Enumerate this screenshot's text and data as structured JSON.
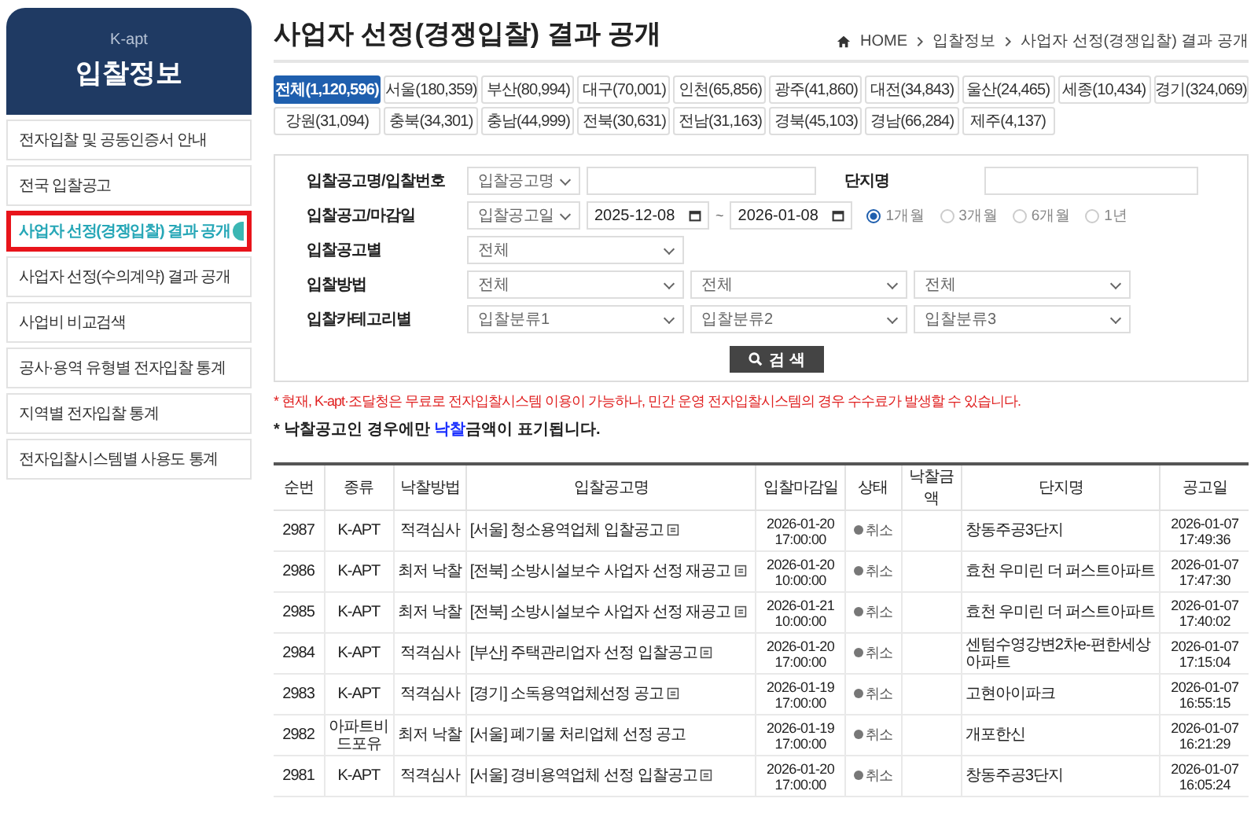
{
  "sidebar": {
    "brand": "K-apt",
    "title": "입찰정보",
    "items": [
      {
        "label": "전자입찰 및 공동인증서 안내",
        "selected": false
      },
      {
        "label": "전국 입찰공고",
        "selected": false
      },
      {
        "label": "사업자 선정(경쟁입찰) 결과 공개",
        "selected": true
      },
      {
        "label": "사업자 선정(수의계약) 결과 공개",
        "selected": false
      },
      {
        "label": "사업비 비교검색",
        "selected": false
      },
      {
        "label": "공사·용역 유형별 전자입찰 통계",
        "selected": false
      },
      {
        "label": "지역별 전자입찰 통계",
        "selected": false
      },
      {
        "label": "전자입찰시스템별 사용도 통계",
        "selected": false
      }
    ]
  },
  "page_title": "사업자 선정(경쟁입찰) 결과 공개",
  "breadcrumb": [
    "HOME",
    "입찰정보",
    "사업자 선정(경쟁입찰) 결과 공개"
  ],
  "regions": [
    {
      "label": "전체(1,120,596)",
      "selected": true
    },
    {
      "label": "서울(180,359)",
      "selected": false
    },
    {
      "label": "부산(80,994)",
      "selected": false
    },
    {
      "label": "대구(70,001)",
      "selected": false
    },
    {
      "label": "인천(65,856)",
      "selected": false
    },
    {
      "label": "광주(41,860)",
      "selected": false
    },
    {
      "label": "대전(34,843)",
      "selected": false
    },
    {
      "label": "울산(24,465)",
      "selected": false
    },
    {
      "label": "세종(10,434)",
      "selected": false
    },
    {
      "label": "경기(324,069)",
      "selected": false
    },
    {
      "label": "강원(31,094)",
      "selected": false
    },
    {
      "label": "충북(34,301)",
      "selected": false
    },
    {
      "label": "충남(44,999)",
      "selected": false
    },
    {
      "label": "전북(30,631)",
      "selected": false
    },
    {
      "label": "전남(31,163)",
      "selected": false
    },
    {
      "label": "경북(45,103)",
      "selected": false
    },
    {
      "label": "경남(66,284)",
      "selected": false
    },
    {
      "label": "제주(4,137)",
      "selected": false
    }
  ],
  "search": {
    "name_label": "입찰공고명/입찰번호",
    "name_select": "입찰공고명",
    "complex_label": "단지명",
    "date_label": "입찰공고/마감일",
    "date_select": "입찰공고일",
    "date_from": "2025-12-08",
    "date_sep": "~",
    "date_to": "2026-01-08",
    "periods": [
      {
        "label": "1개월",
        "selected": true
      },
      {
        "label": "3개월",
        "selected": false
      },
      {
        "label": "6개월",
        "selected": false
      },
      {
        "label": "1년",
        "selected": false
      }
    ],
    "type_label": "입찰공고별",
    "type_select": "전체",
    "method_label": "입찰방법",
    "method_selects": [
      "전체",
      "전체",
      "전체"
    ],
    "category_label": "입찰카테고리별",
    "category_selects": [
      "입찰분류1",
      "입찰분류2",
      "입찰분류3"
    ],
    "button": "검 색"
  },
  "notice_red": "* 현재, K-apt·조달청은 무료로 전자입찰시스템 이용이 가능하나, 민간 운영 전자입찰시스템의 경우 수수료가 발생할 수 있습니다.",
  "notice_black": {
    "before": "* 낙찰공고인 경우에만 ",
    "highlight": "낙찰",
    "after": "금액이 표기됩니다."
  },
  "table": {
    "columns": [
      "순번",
      "종류",
      "낙찰방법",
      "입찰공고명",
      "입찰마감일",
      "상태",
      "낙찰금액",
      "단지명",
      "공고일"
    ],
    "rows": [
      {
        "no": "2987",
        "kind": "K-APT",
        "method": "적격심사",
        "title": "[서울] 청소용역업체 입찰공고",
        "file": true,
        "deadline": [
          "2026-01-20",
          "17:00:00"
        ],
        "status": "취소",
        "complex": "창동주공3단지",
        "posted": [
          "2026-01-07",
          "17:49:36"
        ]
      },
      {
        "no": "2986",
        "kind": "K-APT",
        "method": "최저 낙찰",
        "title": "[전북] 소방시설보수 사업자 선정 재공고",
        "file": true,
        "deadline": [
          "2026-01-20",
          "10:00:00"
        ],
        "status": "취소",
        "complex": "효천 우미린 더 퍼스트아파트",
        "posted": [
          "2026-01-07",
          "17:47:30"
        ]
      },
      {
        "no": "2985",
        "kind": "K-APT",
        "method": "최저 낙찰",
        "title": "[전북] 소방시설보수 사업자 선정 재공고",
        "file": true,
        "deadline": [
          "2026-01-21",
          "10:00:00"
        ],
        "status": "취소",
        "complex": "효천 우미린 더 퍼스트아파트",
        "posted": [
          "2026-01-07",
          "17:40:02"
        ]
      },
      {
        "no": "2984",
        "kind": "K-APT",
        "method": "적격심사",
        "title": "[부산] 주택관리업자 선정 입찰공고",
        "file": true,
        "deadline": [
          "2026-01-20",
          "17:00:00"
        ],
        "status": "취소",
        "complex": "센텀수영강변2차e-편한세상아파트",
        "posted": [
          "2026-01-07",
          "17:15:04"
        ]
      },
      {
        "no": "2983",
        "kind": "K-APT",
        "method": "적격심사",
        "title": "[경기] 소독용역업체선정 공고",
        "file": true,
        "deadline": [
          "2026-01-19",
          "17:00:00"
        ],
        "status": "취소",
        "complex": "고현아이파크",
        "posted": [
          "2026-01-07",
          "16:55:15"
        ]
      },
      {
        "no": "2982",
        "kind": "아파트비드포유",
        "method": "최저 낙찰",
        "title": "[서울] 폐기물 처리업체 선정 공고",
        "file": false,
        "deadline": [
          "2026-01-19",
          "17:00:00"
        ],
        "status": "취소",
        "complex": "개포한신",
        "posted": [
          "2026-01-07",
          "16:21:29"
        ]
      },
      {
        "no": "2981",
        "kind": "K-APT",
        "method": "적격심사",
        "title": "[서울] 경비용역업체 선정 입찰공고",
        "file": true,
        "deadline": [
          "2026-01-20",
          "17:00:00"
        ],
        "status": "취소",
        "complex": "창동주공3단지",
        "posted": [
          "2026-01-07",
          "16:05:24"
        ]
      }
    ]
  }
}
